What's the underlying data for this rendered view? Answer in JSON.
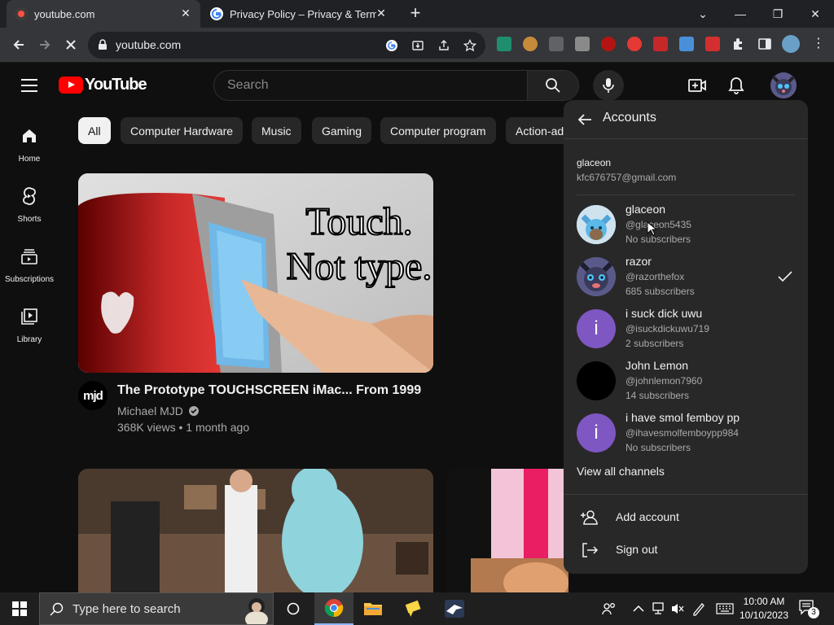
{
  "browser": {
    "tabs": [
      {
        "title": "youtube.com",
        "active": true
      },
      {
        "title": "Privacy Policy – Privacy & Terms –",
        "active": false
      }
    ],
    "url": "youtube.com"
  },
  "youtube": {
    "logo_text": "YouTube",
    "search_placeholder": "Search",
    "sidebar": [
      {
        "label": "Home"
      },
      {
        "label": "Shorts"
      },
      {
        "label": "Subscriptions"
      },
      {
        "label": "Library"
      }
    ],
    "chips": [
      "All",
      "Computer Hardware",
      "Music",
      "Gaming",
      "Computer program",
      "Action-ad"
    ],
    "video": {
      "thumbnail_text_line1": "Touch.",
      "thumbnail_text_line2": "Not type.",
      "channel_avatar_text": "mjd",
      "title": "The Prototype TOUCHSCREEN iMac... From 1999",
      "channel": "Michael MJD",
      "meta": "368K views • 1 month ago"
    }
  },
  "accounts_menu": {
    "title": "Accounts",
    "owner_name": "glaceon",
    "owner_email": "kfc676757@gmail.com",
    "channels": [
      {
        "name": "glaceon",
        "handle": "@glaceon5435",
        "subs": "No subscribers",
        "avatar": "glaceon",
        "selected": false
      },
      {
        "name": "razor",
        "handle": "@razorthefox",
        "subs": "685 subscribers",
        "avatar": "fox",
        "selected": true
      },
      {
        "name": "i suck dick uwu",
        "handle": "@isuckdickuwu719",
        "subs": "2 subscribers",
        "avatar_letter": "i",
        "selected": false
      },
      {
        "name": "John Lemon",
        "handle": "@johnlemon7960",
        "subs": "14 subscribers",
        "avatar": "black",
        "selected": false
      },
      {
        "name": "i have smol femboy pp",
        "handle": "@ihavesmolfemboypp984",
        "subs": "No subscribers",
        "avatar_letter": "i",
        "selected": false
      }
    ],
    "view_all": "View all channels",
    "add_account": "Add account",
    "sign_out": "Sign out"
  },
  "taskbar": {
    "search_text": "Type here to search",
    "time": "10:00 AM",
    "date": "10/10/2023",
    "notification_count": "3"
  },
  "colors": {
    "youtube_red": "#ff0000",
    "background": "#0f0f0f",
    "menu_bg": "#282828",
    "letter_avatar_purple": "#7e57c2"
  }
}
